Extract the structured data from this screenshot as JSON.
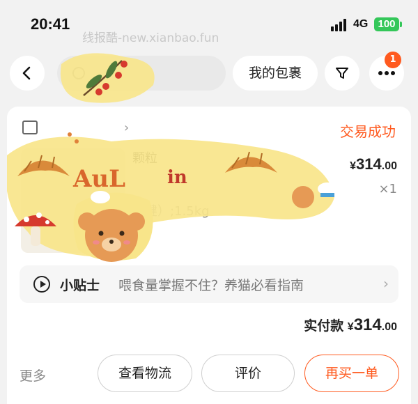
{
  "status_bar": {
    "time": "20:41",
    "network": "4G",
    "battery": "100"
  },
  "watermark": "线报酷-new.xianbao.fun",
  "nav": {
    "my_packages": "我的包裹"
  },
  "badge_count": "1",
  "order": {
    "shop_name": "",
    "status": "交易成功",
    "product": {
      "title": "颗粒",
      "spec": "保健）;1.5kg",
      "price_currency": "¥",
      "price_int": "314",
      "price_dec": ".00",
      "quantity": "×1"
    },
    "tip": {
      "title": "小贴士",
      "text": "喂食量掌握不住？养猫必看指南"
    },
    "total": {
      "label": "实付款",
      "currency": "¥",
      "int": "314",
      "dec": ".00"
    },
    "actions": {
      "more": "更多",
      "logistics": "查看物流",
      "review": "评价",
      "rebuy": "再买一单"
    }
  },
  "colors": {
    "accent": "#ff5a1f",
    "battery": "#34c759"
  },
  "icons": [
    "back-icon",
    "search-icon",
    "filter-icon",
    "more-icon",
    "shop-icon",
    "play-icon",
    "chevron-right-icon"
  ]
}
